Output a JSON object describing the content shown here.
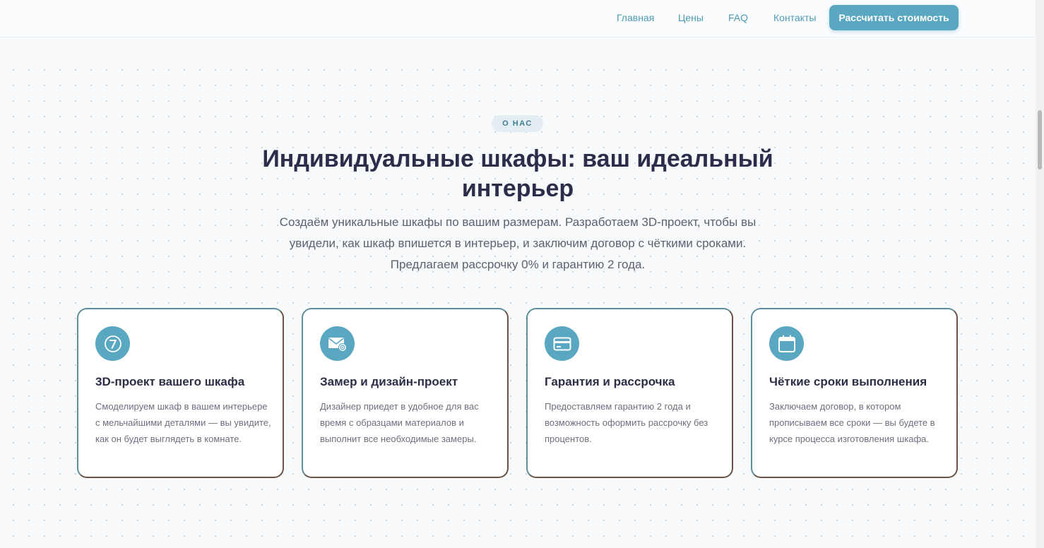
{
  "nav": {
    "links": [
      "Главная",
      "Цены",
      "FAQ",
      "Контакты"
    ],
    "cta": "Рассчитать стоимость"
  },
  "about": {
    "badge": "О НАС",
    "title": "Индивидуальные шкафы: ваш идеальный интерьер",
    "description": "Создаём уникальные шкафы по вашим размерам. Разработаем 3D-проект, чтобы вы увидели, как шкаф впишется в интерьер, и заключим договор с чёткими сроками. Предлагаем рассрочку 0% и гарантию 2 года."
  },
  "features": [
    {
      "icon": "number-7-icon",
      "title": "3D-проект вашего шкафа",
      "text": "Смоделируем шкаф в вашем интерьере с мельчайшими деталями — вы увидите, как он будет выглядеть в комнате."
    },
    {
      "icon": "mail-icon",
      "title": "Замер и дизайн-проект",
      "text": "Дизайнер приедет в удобное для вас время с образцами материалов и выполнит все необходимые замеры."
    },
    {
      "icon": "credit-card-icon",
      "title": "Гарантия и рассрочка",
      "text": "Предоставляем гарантию 2 года и возможность оформить рассрочку без процентов."
    },
    {
      "icon": "calendar-icon",
      "title": "Чёткие сроки выполнения",
      "text": "Заключаем договор, в котором прописываем все сроки — вы будете в курсе процесса изготовления шкафа."
    }
  ],
  "colors": {
    "accent": "#59a7c1",
    "nav_link": "#4d9bb3",
    "heading": "#2b2e4a",
    "badge_bg": "#e4eef2"
  }
}
